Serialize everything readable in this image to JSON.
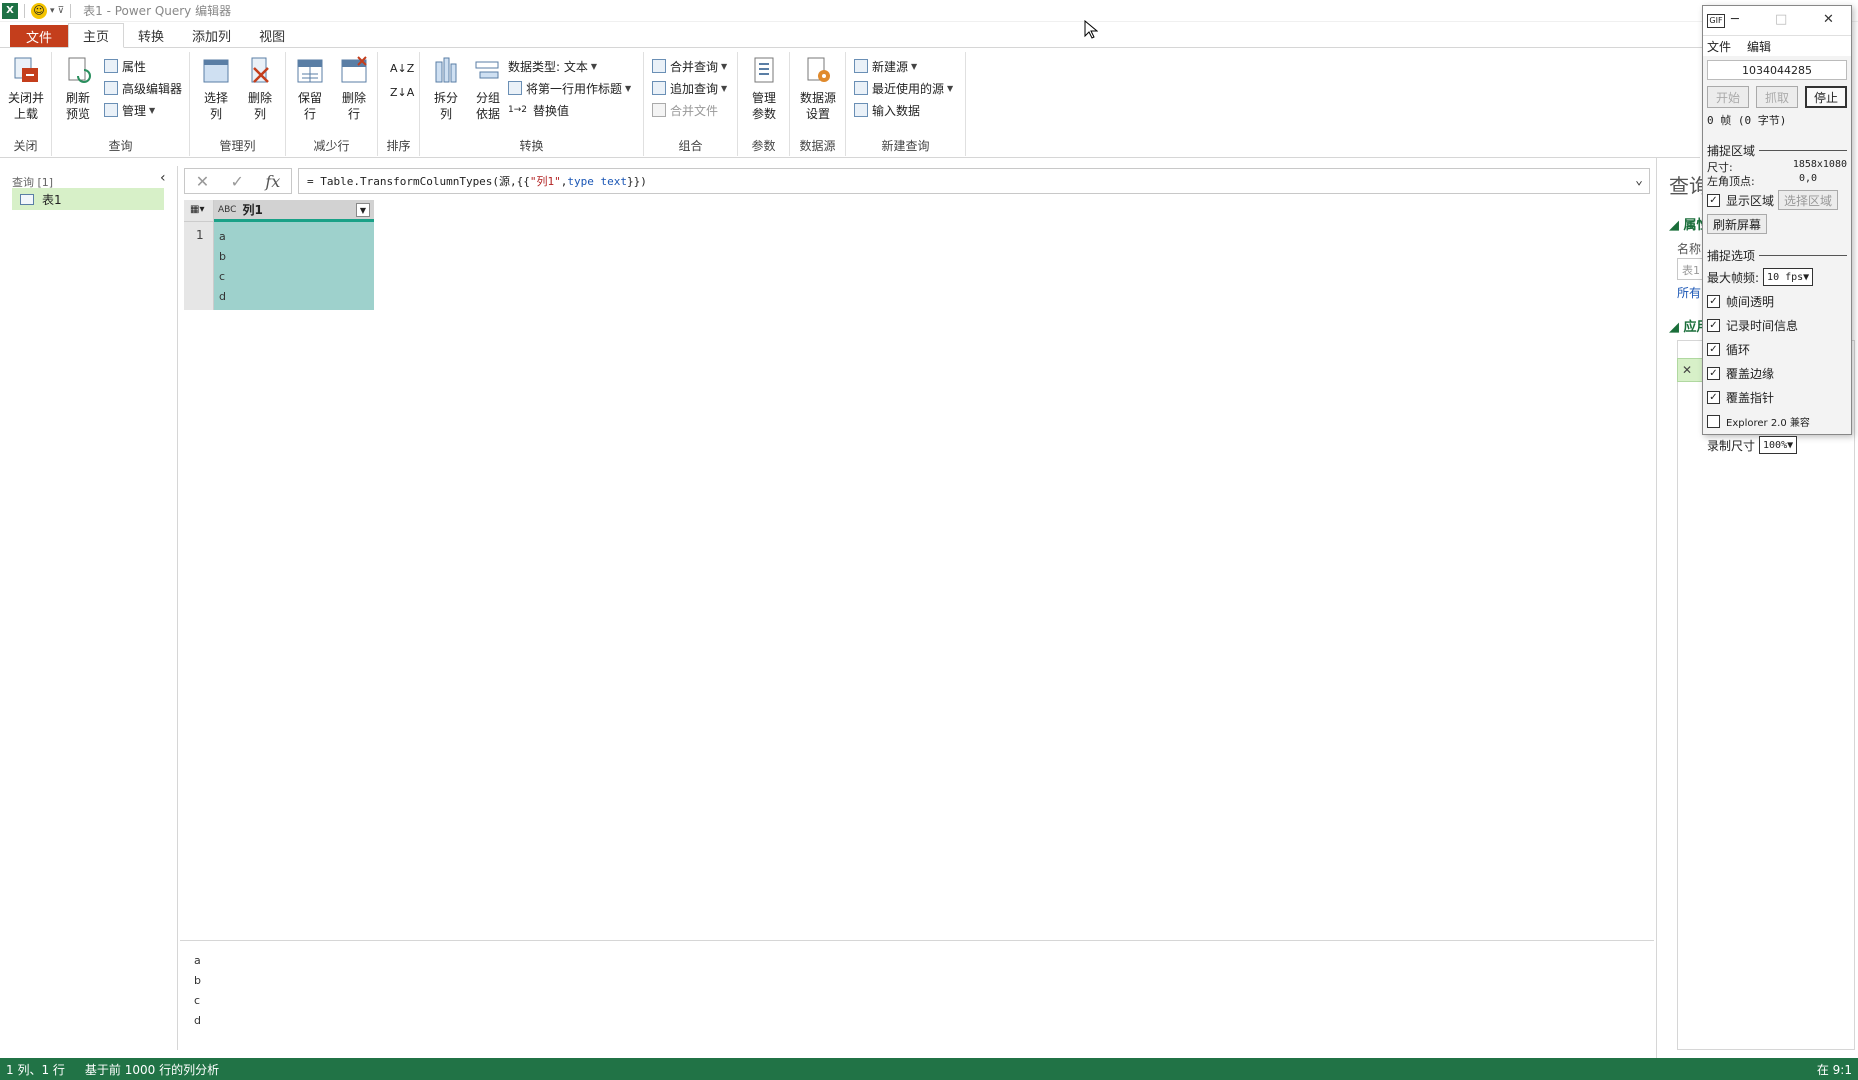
{
  "titlebar": {
    "app_icon": "X",
    "title": "表1 - Power Query 编辑器"
  },
  "tabs": [
    "文件",
    "主页",
    "转换",
    "添加列",
    "视图"
  ],
  "ribbon": {
    "close_group": {
      "btn": "关闭并\n上载",
      "label": "关闭"
    },
    "query_group": {
      "refresh": "刷新\n预览",
      "properties": "属性",
      "advanced_editor": "高级编辑器",
      "manage": "管理",
      "label": "查询"
    },
    "columns_group": {
      "choose": "选择\n列",
      "remove": "删除\n列",
      "label": "管理列"
    },
    "rows_group": {
      "keep": "保留\n行",
      "remove": "删除\n行",
      "label": "减少行"
    },
    "sort_group": {
      "label": "排序"
    },
    "transform_group": {
      "split": "拆分\n列",
      "group_by": "分组\n依据",
      "data_type": "数据类型: 文本",
      "first_row": "将第一行用作标题",
      "replace": "替换值",
      "label": "转换"
    },
    "combine_group": {
      "merge": "合并查询",
      "append": "追加查询",
      "combine_files": "合并文件",
      "label": "组合"
    },
    "params_group": {
      "manage": "管理\n参数",
      "label": "参数"
    },
    "datasource_group": {
      "settings": "数据源\n设置",
      "label": "数据源"
    },
    "newquery_group": {
      "new_source": "新建源",
      "recent": "最近使用的源",
      "enter": "输入数据",
      "label": "新建查询"
    }
  },
  "queries": {
    "title": "查询 [1]",
    "items": [
      "表1"
    ]
  },
  "formula": {
    "prefix": "= Table.TransformColumnTypes(源,{{",
    "col": "\"列1\"",
    "mid": ", ",
    "kw": "type text",
    "suffix": "}})"
  },
  "grid": {
    "type_label": "ABC",
    "column": "列1",
    "row_number": "1",
    "values": [
      "a",
      "b",
      "c",
      "d"
    ]
  },
  "preview": [
    "a",
    "b",
    "c",
    "d"
  ],
  "settings": {
    "title": "查询",
    "properties": "属性",
    "name_label": "名称",
    "name_value": "表1",
    "all_props": "所有",
    "applied_steps": "应用"
  },
  "status": {
    "left1": "1 列、1 行",
    "left2": "基于前 1000 行的列分析",
    "right": "在 9:1"
  },
  "recorder": {
    "logo": "GIF",
    "menu": [
      "文件",
      "编辑"
    ],
    "number": "1034044285",
    "btn_start": "开始",
    "btn_capture": "抓取",
    "btn_stop": "停止",
    "frames": "0 帧 (0 字节)",
    "region_title": "捕捉区域",
    "size_label": "尺寸:",
    "size_value": "1858x1080",
    "topleft_label": "左角顶点:",
    "topleft_value": "0,0",
    "show_region": "显示区域",
    "select_region": "选择区域",
    "refresh_screen": "刷新屏幕",
    "options_title": "捕捉选项",
    "max_fps_label": "最大帧频:",
    "max_fps_value": "10 fps",
    "opt_transparent": "帧间透明",
    "opt_timestamp": "记录时间信息",
    "opt_loop": "循环",
    "opt_border": "覆盖边缘",
    "opt_pointer": "覆盖指针",
    "opt_explorer": "Explorer 2.0 兼容",
    "rec_size_label": "录制尺寸",
    "rec_size_value": "100%"
  }
}
